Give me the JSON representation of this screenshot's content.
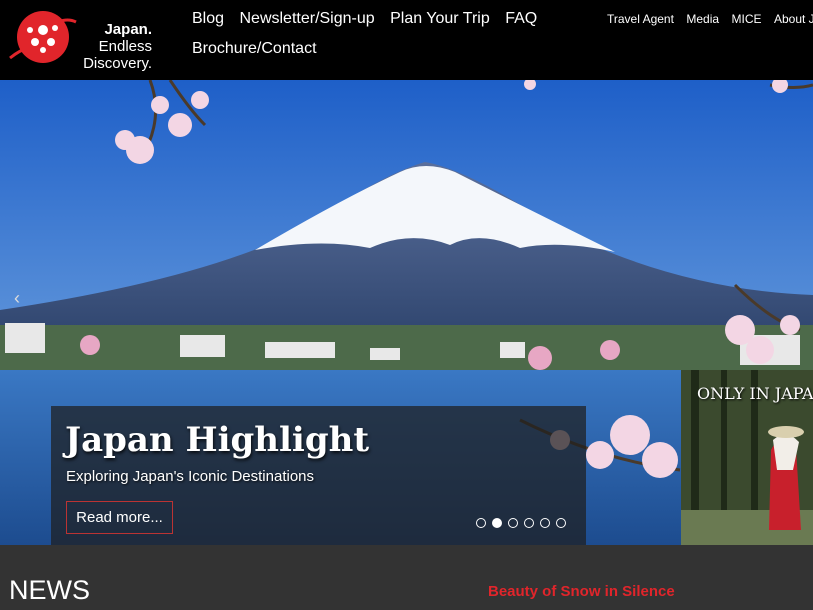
{
  "header": {
    "logo": {
      "line1": "Japan.",
      "line2": "Endless",
      "line3": "Discovery."
    },
    "main_nav": [
      "Blog",
      "Newsletter/Sign-up",
      "Plan Your Trip",
      "FAQ",
      "Brochure/Contact"
    ],
    "utility_nav": [
      "Travel Agent",
      "Media",
      "MICE",
      "About JN"
    ]
  },
  "hero": {
    "prev_arrow": "‹",
    "slide": {
      "title": "Japan Highlight",
      "subtitle": "Exploring Japan's Iconic Destinations",
      "button": "Read more..."
    },
    "dots": {
      "count": 6,
      "active_index": 1
    },
    "side_promo": {
      "title": "ONLY IN JAPAN"
    }
  },
  "news": {
    "heading": "NEWS",
    "featured_link": "Beauty of Snow in Silence"
  },
  "colors": {
    "accent_red": "#e1252b",
    "header_bg": "#000000",
    "bottom_bg": "#333333"
  }
}
